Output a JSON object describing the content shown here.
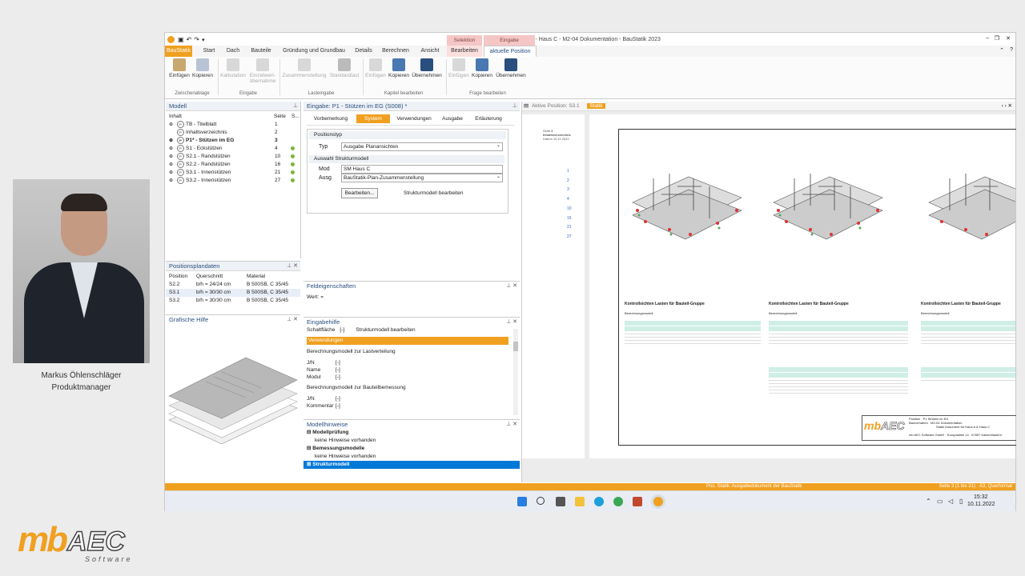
{
  "presenter": {
    "name": "Markus Öhlenschläger",
    "role": "Produktmanager"
  },
  "logo": {
    "mb": "mb",
    "aec": "AEC",
    "software": "Software"
  },
  "window": {
    "title": "Statik - Haus C - M2-04 Dokumentation - BauStatik 2023",
    "controls": [
      "–",
      "❐",
      "✕"
    ]
  },
  "context_tabs": {
    "selektion": "Selektion",
    "eingabe": "Eingabe"
  },
  "menu_tabs": [
    "BauStatik",
    "Start",
    "Dach",
    "Bauteile",
    "Gründung und Grundbau",
    "Details",
    "Berechnen",
    "Ansicht",
    "Bearbeiten",
    "aktuelle Position"
  ],
  "ribbon": {
    "buttons": [
      {
        "label": "Einfügen"
      },
      {
        "label": "Kopieren"
      },
      {
        "label": "Kalkulation"
      },
      {
        "label": "Einzelwert-übernahme"
      },
      {
        "label": "Zusammenstellung"
      },
      {
        "label": "Standardlast"
      },
      {
        "label": "Einfügen"
      },
      {
        "label": "Kopieren"
      },
      {
        "label": "Übernehmen"
      },
      {
        "label": "Einfügen"
      },
      {
        "label": "Kopieren"
      },
      {
        "label": "Übernehmen"
      }
    ],
    "groups": [
      "Zwischenablage",
      "Eingabe",
      "Lasteingabe",
      "Kapitel bearbeiten",
      "Frage bearbeiten"
    ]
  },
  "modell": {
    "title": "Modell",
    "columns": [
      "Inhalt",
      "Seite",
      "S..."
    ],
    "items": [
      {
        "label": "TB - Titelblatt",
        "page": "1",
        "status": false
      },
      {
        "label": "Inhaltsverzeichnis",
        "page": "2",
        "status": false
      },
      {
        "label": "P1* - Stützen im EG",
        "page": "3",
        "status": false
      },
      {
        "label": "S1 - Eckstützen",
        "page": "4",
        "status": true
      },
      {
        "label": "S2.1 - Randstützen",
        "page": "10",
        "status": true
      },
      {
        "label": "S2.2 - Randstützen",
        "page": "16",
        "status": true
      },
      {
        "label": "S3.1 - Innenstützen",
        "page": "21",
        "status": true
      },
      {
        "label": "S3.2 - Innenstützen",
        "page": "27",
        "status": true
      }
    ]
  },
  "positionsplan": {
    "title": "Positionsplandaten",
    "columns": [
      "Position",
      "Querschnitt",
      "Material"
    ],
    "rows": [
      [
        "S2.2",
        "b/h = 24/24 cm",
        "B 500SB, C 35/45"
      ],
      [
        "S3.1",
        "b/h = 30/30 cm",
        "B 500SB, C 35/45"
      ],
      [
        "S3.2",
        "b/h = 30/30 cm",
        "B 500SB, C 35/45"
      ]
    ]
  },
  "grafische_hilfe": {
    "title": "Grafische Hilfe"
  },
  "eingabe": {
    "title": "Eingabe: P1 - Stützen im EG (S008) *",
    "tabs": [
      "Vorbemerkung",
      "System",
      "Verwendungen",
      "Ausgabe",
      "Erläuterung"
    ],
    "positionstyp": {
      "heading": "Positionstyp",
      "typ_label": "Typ",
      "typ_value": "Ausgabe Planansichten"
    },
    "struktur": {
      "heading": "Auswahl Strukturmodell",
      "mod_label": "Mod",
      "mod_value": "SM Haus C",
      "ausg_label": "Ausg",
      "ausg_value": "BauStatik-Plan-Zusammenstellung",
      "button": "Bearbeiten...",
      "button_text": "Strukturmodell bearbeiten"
    }
  },
  "feldeigenschaften": {
    "title": "Feldeigenschaften",
    "wert": "Wert: ="
  },
  "eingabehilfe": {
    "title": "Eingabehilfe",
    "schalt_label": "Schaltfläche",
    "schalt_mark": "[-]",
    "schalt_value": "Strukturmodell bearbeiten",
    "section": "Verwendungen",
    "text1": "Berechnungsmodell zur Lastverteilung",
    "fields1": [
      {
        "k": "J/N",
        "v": "[-]"
      },
      {
        "k": "Name",
        "v": "[-]"
      },
      {
        "k": "Modul",
        "v": "[-]"
      }
    ],
    "text2": "Berechnungsmodell zur Bauteilbemessung",
    "fields2": [
      {
        "k": "J/N",
        "v": "[-]"
      },
      {
        "k": "Kommentar",
        "v": "[-]"
      }
    ]
  },
  "modellhinweise": {
    "title": "Modellhinweise",
    "items": [
      {
        "label": "Modellprüfung",
        "sub": "keine Hinweise vorhanden"
      },
      {
        "label": "Bemessungsmodelle",
        "sub": "keine Hinweise vorhanden"
      },
      {
        "label": "Strukturmodell",
        "sub": ""
      }
    ]
  },
  "preview": {
    "header_label": "Aktive Position: S3.1",
    "header_tab": "Statik",
    "nav": "‹ › ✕",
    "left_page": {
      "seite_label": "Seite",
      "seite_value": "2",
      "inhalt": "Inhaltsverzeichnis",
      "datum_label": "Datum",
      "datum_value": "10.11.2022",
      "numbers": [
        "1",
        "2",
        "3",
        "4",
        "10",
        "16",
        "21",
        "27"
      ]
    },
    "kontroll_title": "Kontrollsichten Lasten für Bauteil-Gruppe",
    "berechnungsmodell": "Berechnungsmodell",
    "titleblock": {
      "position_label": "Position",
      "position_value": "P1 Stützen im EG",
      "bauvorhaben_label": "Bauvorhaben",
      "line1": "M2-04 Dokumentation",
      "line2": "Statik Dokument für Haus A & Haus C",
      "company": "mb AEC Software GmbH · Europaallee 14 · 67657 Kaiserslautern"
    }
  },
  "statusbar": {
    "left": "Pos. Statik: Ausgabedokument der BauStatik",
    "right": "Seite 3 (1 bis 31) · A3, Querformat"
  },
  "taskbar": {
    "time": "15:32",
    "date": "10.11.2022"
  },
  "colors": {
    "accent": "#f0a020",
    "selected": "#0078d7",
    "green": "#7cb83a",
    "context_tab": "#f4c6c6"
  }
}
